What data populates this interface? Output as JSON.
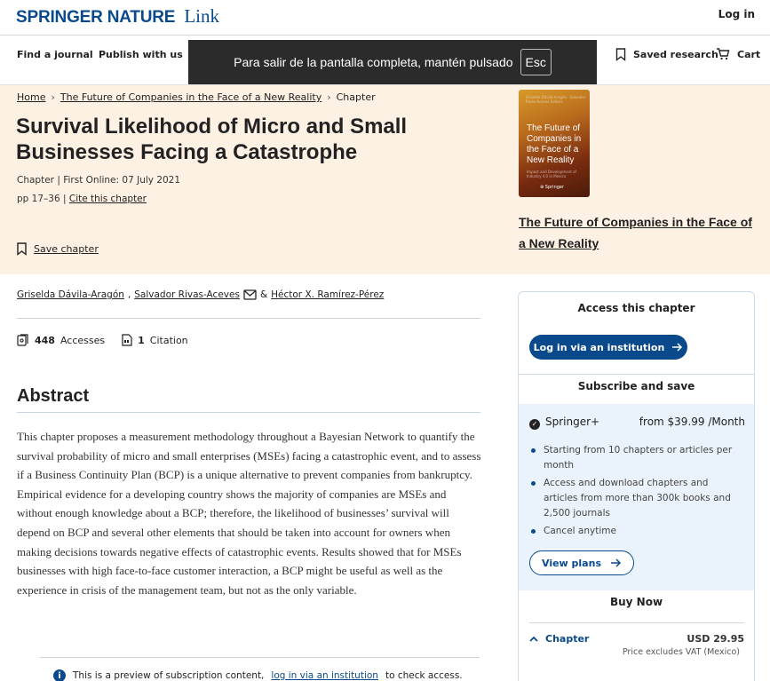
{
  "header": {
    "brand": "SPRINGER NATURE",
    "brand_suffix": "Link",
    "login": "Log in"
  },
  "nav": {
    "find_journal": "Find a journal",
    "publish": "Publish with us",
    "saved_research": "Saved research",
    "cart": "Cart"
  },
  "fullscreen_notice": {
    "text": "Para salir de la pantalla completa, mantén pulsado",
    "key": "Esc"
  },
  "breadcrumb": {
    "home": "Home",
    "book": "The Future of Companies in the Face of a New Reality",
    "current": "Chapter"
  },
  "article": {
    "title": "Survival Likelihood of Micro and Small Businesses Facing a Catastrophe",
    "type": "Chapter",
    "first_online": "First Online: 07 July 2021",
    "pages": "pp 17–36",
    "cite": "Cite this chapter",
    "save": "Save chapter"
  },
  "book": {
    "title": "The Future of Companies in the Face of a New Reality",
    "cover_title": "The Future of Companies in the Face of a New Reality",
    "cover_editors": "Griselda Dávila-Aragón · Salvador Rivas-Aceves  Editors",
    "cover_subtitle": "Impact and Development of Industry 4.0 in Mexico",
    "cover_publisher": "⊕ Springer"
  },
  "authors": {
    "a1": "Griselda Dávila-Aragón",
    "sep1": ",",
    "a2": "Salvador Rivas-Aceves",
    "sep2": "&",
    "a3": "Héctor X. Ramírez-Pérez"
  },
  "metrics": {
    "accesses_count": "448",
    "accesses_label": "Accesses",
    "citations_count": "1",
    "citations_label": "Citation"
  },
  "abstract": {
    "heading": "Abstract",
    "body": "This chapter proposes a measurement methodology throughout a Bayesian Network to quantify the survival probability of micro and small enterprises (MSEs) facing a catastrophic event, and to assess if a Business Continuity Plan (BCP) is a unique alternative to prevent companies from bankruptcy. Empirical evidence for a developing country shows the majority of companies are MSEs and without enough knowledge about a BCP; therefore, the likelihood of businesses’ survival will depend on BCP and several other elements that should be taken into account for owners when making decisions towards negative effects of catastrophic events. Results showed that for MSEs businesses with high face-to-face customer interaction, a BCP might be useful as well as the experience in crisis of the management team, but not as the only variable."
  },
  "preview": {
    "pre": "This is a preview of subscription content,",
    "link": "log in via an institution",
    "post": "to check access."
  },
  "access_panel": {
    "title": "Access this chapter",
    "institution_button": "Log in via an institution",
    "subscribe_title": "Subscribe and save",
    "plan_name": "Springer+",
    "plan_price": "from $39.99 /Month",
    "plan_features": [
      "Starting from 10 chapters or articles per month",
      "Access and download chapters and articles from more than 300k books and 2,500 journals",
      "Cancel anytime"
    ],
    "view_plans": "View plans",
    "buy_title": "Buy Now",
    "buy_item": "Chapter",
    "buy_price": "USD 29.95",
    "vat_note": "Price excludes VAT (Mexico)"
  },
  "colors": {
    "brand_blue": "#0a4a8c",
    "hero_bg": "#fdf1e3",
    "subscribe_bg": "#eaf3fb"
  }
}
